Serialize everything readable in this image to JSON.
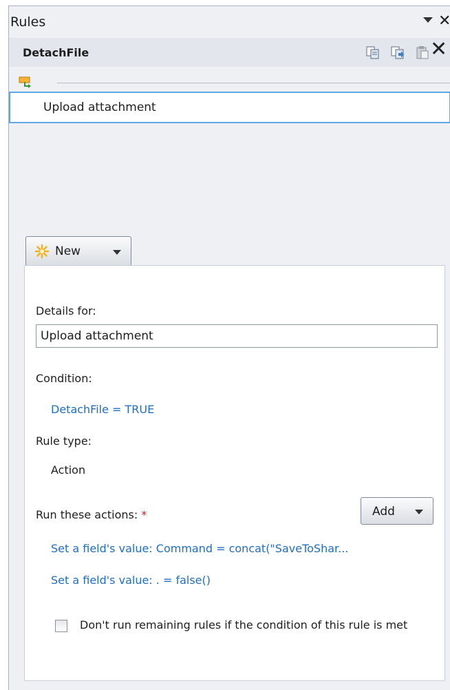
{
  "pane": {
    "title": "Rules",
    "colors": {
      "selection_border": "#5ca7e4",
      "link": "#1f6fc5",
      "required": "#d11a1a"
    }
  },
  "toolbar": {
    "rule_name": "DetachFile",
    "icons": [
      "copy-rule-icon",
      "copy-all-rules-icon",
      "paste-rule-icon",
      "delete-icon"
    ]
  },
  "rules_list": {
    "items": [
      {
        "label": "Upload attachment",
        "selected": true
      }
    ]
  },
  "new_button": {
    "label": "New"
  },
  "details": {
    "details_for_label": "Details for:",
    "rule_name_value": "Upload attachment",
    "condition_label": "Condition:",
    "condition_value": "DetachFile = TRUE",
    "rule_type_label": "Rule type:",
    "rule_type_value": "Action",
    "actions_label": "Run these actions:",
    "required_mark": "*",
    "add_button_label": "Add",
    "actions": [
      "Set a field's value: Command = concat(\"SaveToShar...",
      "Set a field's value: . = false()"
    ],
    "stop_checkbox_label": "Don't run remaining rules if the condition of this rule is met",
    "stop_checkbox_checked": false
  }
}
